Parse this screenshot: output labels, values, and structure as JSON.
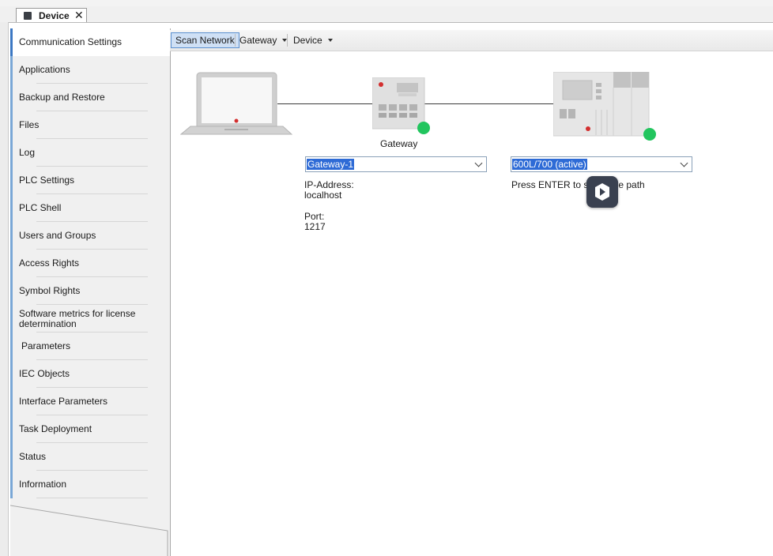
{
  "tab": {
    "title": "Device",
    "close": "✕",
    "icon": "device-icon"
  },
  "sidebar": {
    "items": [
      {
        "label": "Communication Settings",
        "active": true
      },
      {
        "label": "Applications"
      },
      {
        "label": "Backup and Restore"
      },
      {
        "label": "Files"
      },
      {
        "label": "Log"
      },
      {
        "label": "PLC Settings"
      },
      {
        "label": "PLC Shell"
      },
      {
        "label": "Users and Groups"
      },
      {
        "label": "Access Rights"
      },
      {
        "label": "Symbol Rights"
      },
      {
        "label": "Software metrics for license determination"
      },
      {
        "label": "Parameters"
      },
      {
        "label": "IEC Objects"
      },
      {
        "label": "Interface Parameters"
      },
      {
        "label": "Task Deployment"
      },
      {
        "label": "Status"
      },
      {
        "label": "Information"
      }
    ]
  },
  "toolbar": {
    "scan_network": "Scan Network",
    "gateway": "Gateway",
    "device": "Device"
  },
  "network": {
    "gateway_label": "Gateway",
    "gateway_select": "Gateway-1",
    "ip_label": "IP-Address:",
    "ip_value": "localhost",
    "port_label": "Port:",
    "port_value": "1217",
    "device_select": "600L/700 (active)",
    "hint": "Press ENTER to set active path"
  },
  "colors": {
    "status_online": "#22c55e",
    "selection": "#2e6bd6",
    "accent": "#3c78c3"
  }
}
